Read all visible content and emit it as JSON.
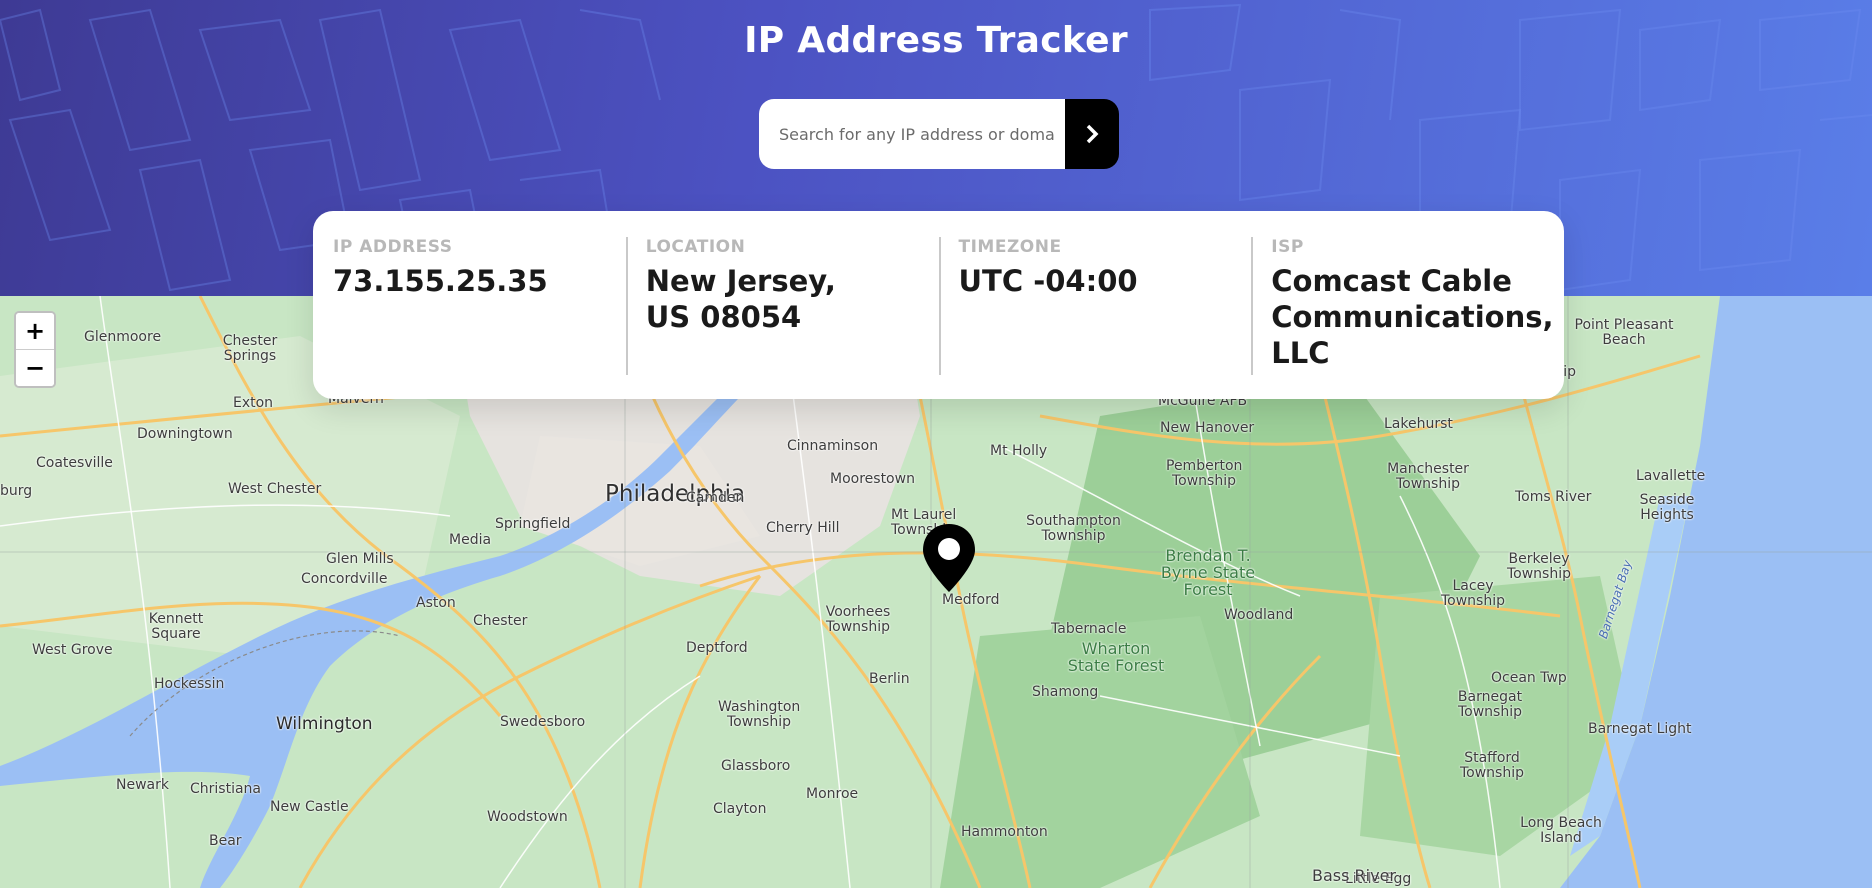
{
  "app": {
    "title": "IP Address Tracker"
  },
  "search": {
    "placeholder": "Search for any IP address or domain",
    "value": "",
    "button_icon": "chevron-right-icon"
  },
  "info": [
    {
      "label": "IP ADDRESS",
      "value": "73.155.25.35"
    },
    {
      "label": "LOCATION",
      "value": "New Jersey, US 08054"
    },
    {
      "label": "TIMEZONE",
      "value": "UTC -04:00"
    },
    {
      "label": "ISP",
      "value": "Comcast Cable Communications, LLC"
    }
  ],
  "map": {
    "zoom_in_label": "+",
    "zoom_out_label": "−",
    "marker_icon": "location-pin-icon",
    "places": {
      "glenmoore": "Glenmoore",
      "chester_springs": "Chester Springs",
      "malvern": "Malvern",
      "exton": "Exton",
      "downingtown": "Downingtown",
      "coatesville": "Coatesville",
      "west_chester": "West Chester",
      "burg": "burg",
      "philadelphia": "Philadelphia",
      "springfield": "Springfield",
      "camden": "Camden",
      "cherry_hill": "Cherry Hill",
      "cinnaminson": "Cinnaminson",
      "moorestown": "Moorestown",
      "mt_laurel": "Mt Laurel Township",
      "mt_holly": "Mt Holly",
      "southampton": "Southampton Township",
      "mcguire": "McGuire AFB",
      "new_hanover": "New Hanover",
      "pemberton": "Pemberton Township",
      "lakehurst": "Lakehurst",
      "manchester": "Manchester Township",
      "toms_river": "Toms River",
      "point_pleasant": "Point Pleasant Beach",
      "brick": "Brick Township",
      "lavallette": "Lavallette",
      "seaside": "Seaside Heights",
      "berkeley": "Berkeley Township",
      "lacey": "Lacey Township",
      "brendan": "Brendan T. Byrne State Forest",
      "woodland": "Woodland",
      "medford": "Medford",
      "tabernacle": "Tabernacle",
      "voorhees": "Voorhees Township",
      "media": "Media",
      "glen_mills": "Glen Mills",
      "concordville": "Concordville",
      "aston": "Aston",
      "chester": "Chester",
      "kennett": "Kennett Square",
      "west_grove": "West Grove",
      "hockessin": "Hockessin",
      "wilmington": "Wilmington",
      "newark": "Newark",
      "christiana": "Christiana",
      "new_castle": "New Castle",
      "bear": "Bear",
      "deptford": "Deptford",
      "berlin": "Berlin",
      "washington": "Washington Township",
      "swedesboro": "Swedesboro",
      "glassboro": "Glassboro",
      "monroe": "Monroe",
      "clayton": "Clayton",
      "woodstown": "Woodstown",
      "hammonton": "Hammonton",
      "shamong": "Shamong",
      "wharton": "Wharton State Forest",
      "ocean_twp": "Ocean Twp",
      "barnegat": "Barnegat Township",
      "barnegat_light": "Barnegat Light",
      "barnegat_bay": "Barnegat Bay",
      "stafford": "Stafford Township",
      "long_beach": "Long Beach Island",
      "little_egg": "Little Egg",
      "bass_river": "Bass River"
    }
  }
}
